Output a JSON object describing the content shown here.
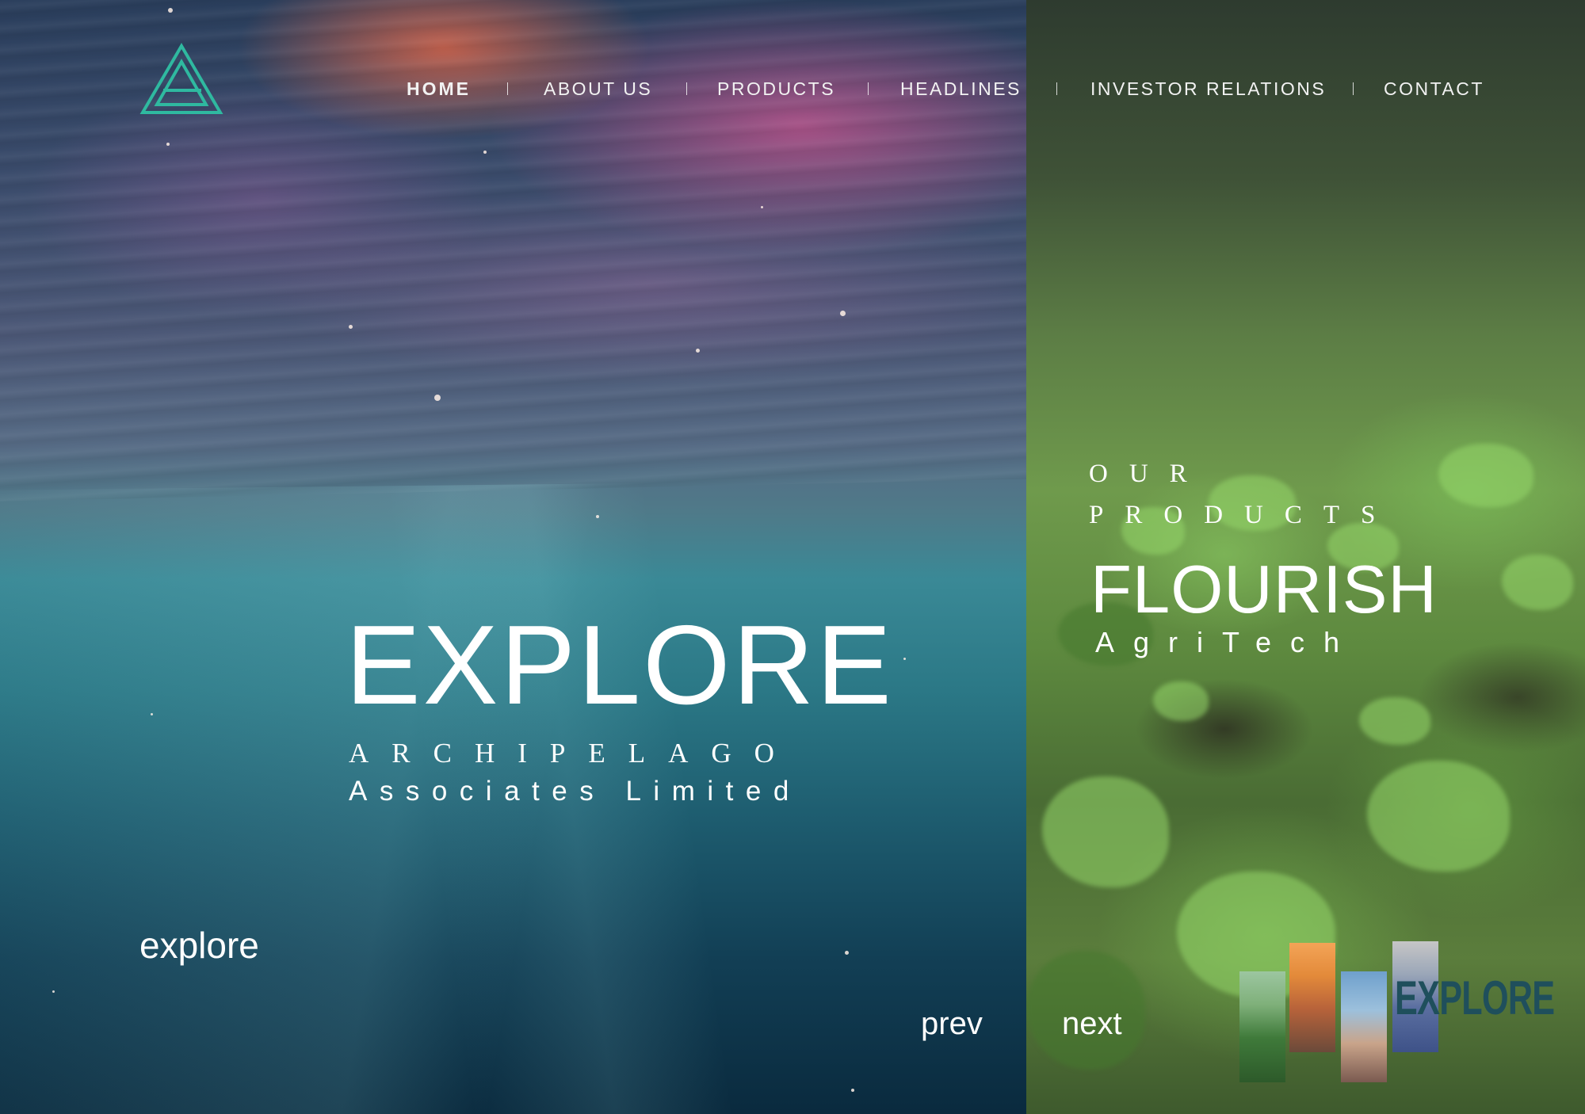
{
  "nav": {
    "items": [
      {
        "label": "HOME",
        "active": true
      },
      {
        "label": "ABOUT US",
        "active": false
      },
      {
        "label": "PRODUCTS",
        "active": false
      },
      {
        "label": "HEADLINES",
        "active": false
      },
      {
        "label": "INVESTOR RELATIONS",
        "active": false
      },
      {
        "label": "CONTACT",
        "active": false
      }
    ]
  },
  "logo": {
    "icon": "archipelago-triangle-logo-icon",
    "color": "#2fb9a0"
  },
  "hero": {
    "title": "EXPLORE",
    "subtitle_line1": "ARCHIPELAGO",
    "subtitle_line2": "Associates Limited",
    "cta": "explore"
  },
  "pager": {
    "prev": "prev",
    "next": "next"
  },
  "products": {
    "label_line1": "OUR",
    "label_line2": "PRODUCTS",
    "title": "FLOURISH",
    "subtitle": "AgriTech",
    "thumbnail_word": "EXPLORE"
  },
  "colors": {
    "text": "#ffffff",
    "logo_teal": "#2fb9a0",
    "thumbnail_word": "#1f4f5c"
  }
}
